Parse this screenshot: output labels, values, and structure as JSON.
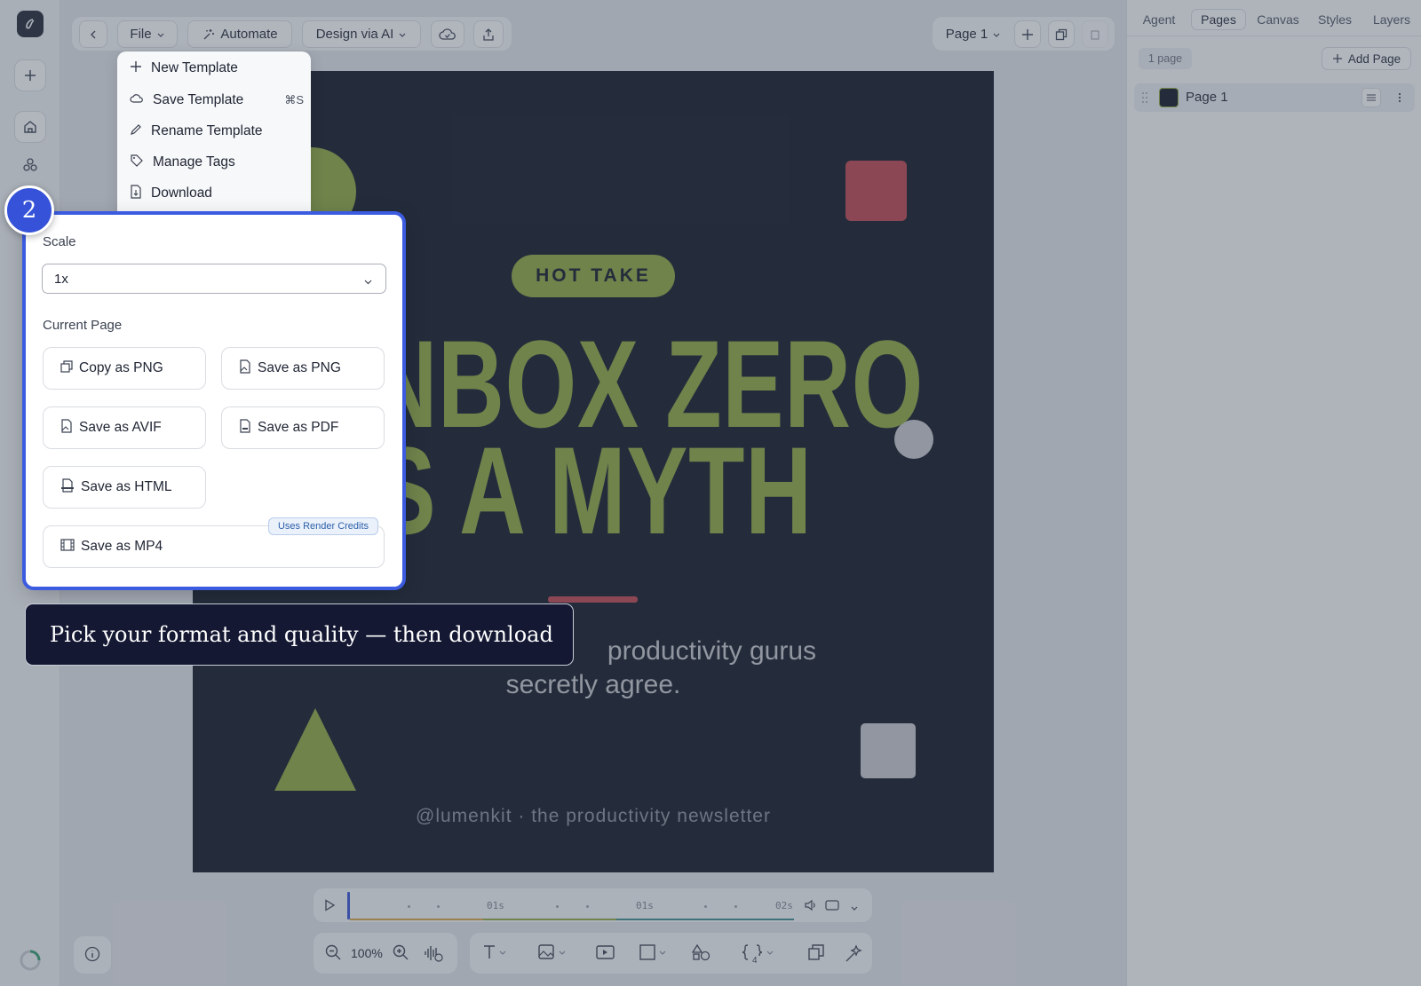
{
  "toolbar": {
    "file_label": "File",
    "automate_label": "Automate",
    "design_ai_label": "Design via AI",
    "page_selector": "Page 1"
  },
  "file_menu": {
    "items": [
      {
        "label": "New Template",
        "icon": "plus-icon",
        "shortcut": ""
      },
      {
        "label": "Save Template",
        "icon": "cloud-save-icon",
        "shortcut": "⌘S"
      },
      {
        "label": "Rename Template",
        "icon": "pencil-icon",
        "shortcut": ""
      },
      {
        "label": "Manage Tags",
        "icon": "tag-icon",
        "shortcut": ""
      },
      {
        "label": "Download",
        "icon": "download-icon",
        "shortcut": ""
      }
    ]
  },
  "right_panel": {
    "tabs": [
      "Agent",
      "Pages",
      "Canvas",
      "Styles",
      "Layers"
    ],
    "active_tab": "Pages",
    "page_count": "1 page",
    "add_page_label": "Add Page",
    "pages": [
      {
        "name": "Page 1"
      }
    ]
  },
  "canvas": {
    "badge": "HOT TAKE",
    "headline_line1": "INBOX ZERO",
    "headline_line2": "IS A MYTH",
    "subtitle_line1": "productivity gurus",
    "subtitle_line2": "secretly agree.",
    "footer": "@lumenkit · the productivity newsletter",
    "colors": {
      "background": "#0d1220",
      "accent_green": "#8ea83c",
      "accent_red": "#c0414a",
      "gray_shape": "#c8c9cd"
    }
  },
  "download_popup": {
    "scale_label": "Scale",
    "scale_value": "1x",
    "section_label": "Current Page",
    "buttons": [
      {
        "label": "Copy as PNG",
        "icon": "copy-icon"
      },
      {
        "label": "Save as PNG",
        "icon": "image-file-icon"
      },
      {
        "label": "Save as AVIF",
        "icon": "image-file-icon"
      },
      {
        "label": "Save as PDF",
        "icon": "pdf-file-icon"
      },
      {
        "label": "Save as HTML",
        "icon": "html-file-icon"
      },
      {
        "label": "Save as MP4",
        "icon": "film-icon"
      }
    ],
    "mp4_badge": "Uses Render Credits"
  },
  "tour": {
    "step_number": "2",
    "tooltip_text": "Pick your format and quality — then download"
  },
  "timeline": {
    "labels": [
      "01s",
      "01s",
      "02s"
    ]
  },
  "bottom_toolbar": {
    "zoom_level": "100%",
    "variables_count": "4"
  }
}
